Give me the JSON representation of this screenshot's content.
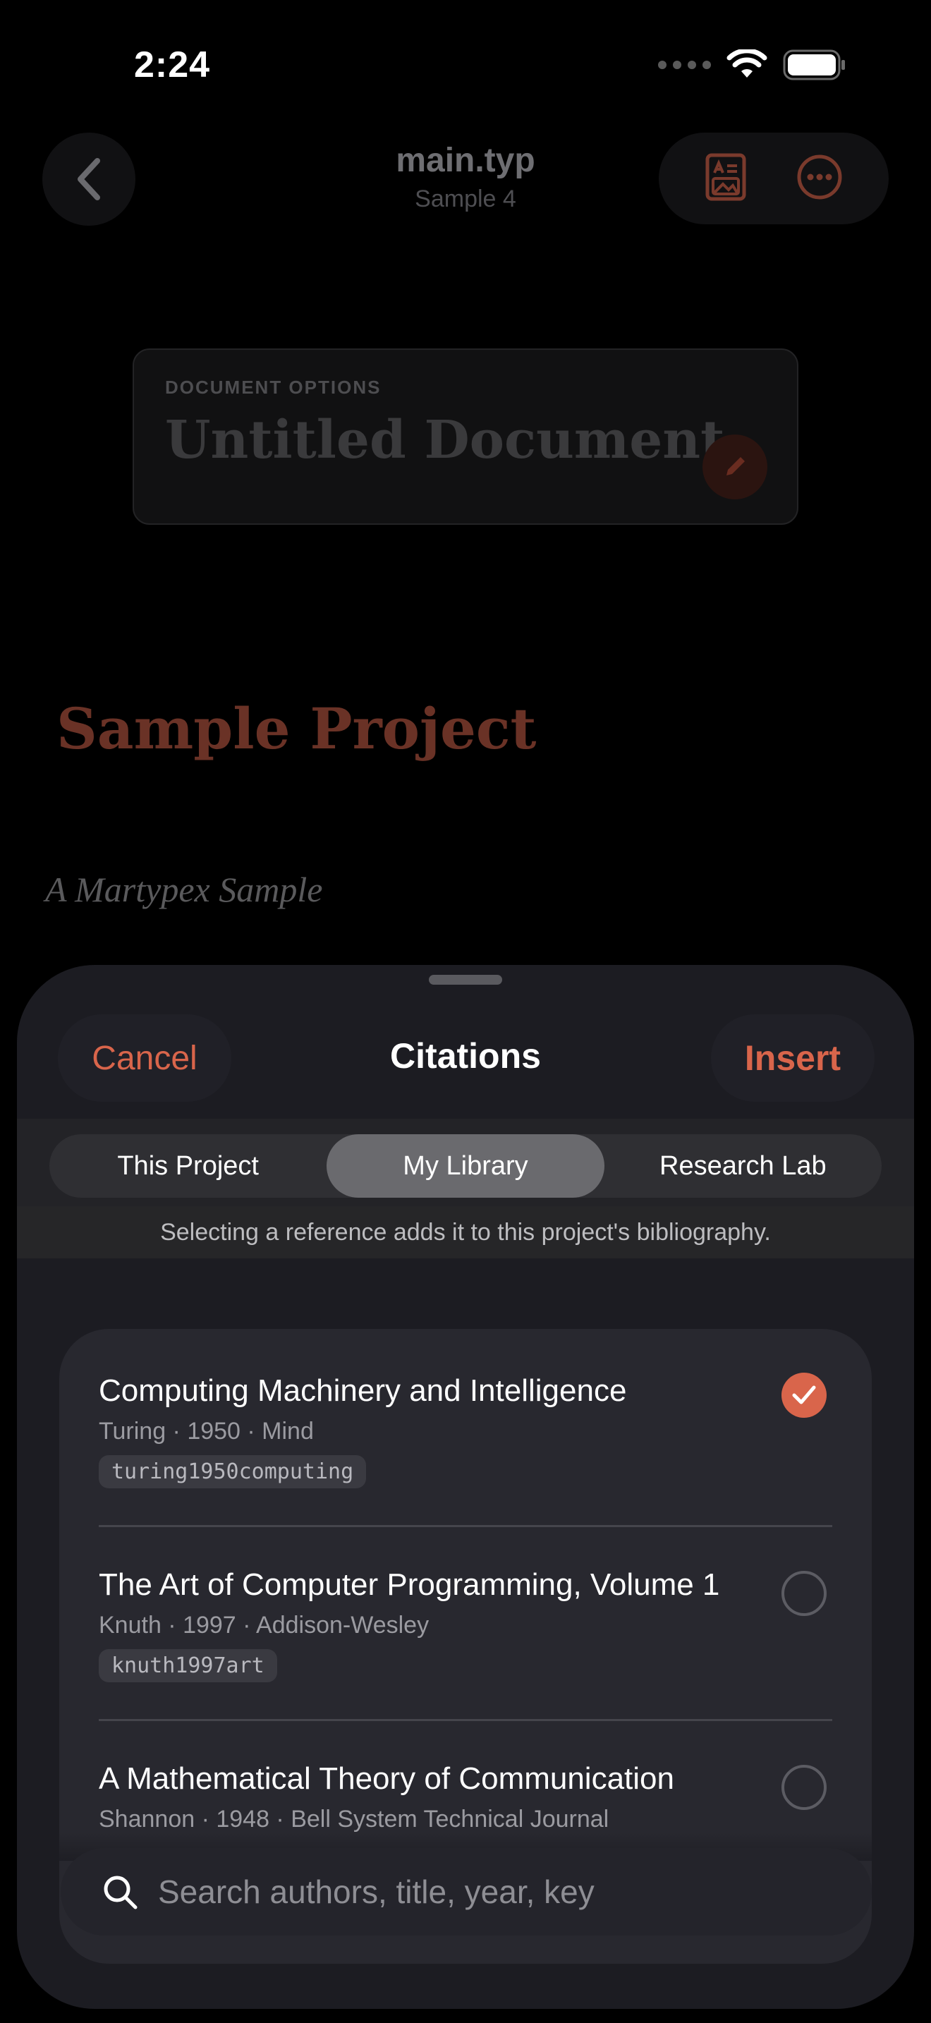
{
  "status_bar": {
    "time": "2:24"
  },
  "nav": {
    "title": "main.typ",
    "subtitle": "Sample 4"
  },
  "document": {
    "options_label": "DOCUMENT OPTIONS",
    "title": "Untitled Document",
    "project_title": "Sample Project",
    "project_subtitle": "A Martypex Sample"
  },
  "sheet": {
    "cancel_label": "Cancel",
    "title": "Citations",
    "insert_label": "Insert",
    "segments": [
      "This Project",
      "My Library",
      "Research Lab"
    ],
    "selected_segment": "My Library",
    "hint": "Selecting a reference adds it to this project's bibliography.",
    "references": [
      {
        "title": "Computing Machinery and Intelligence",
        "meta": "Turing · 1950 · Mind",
        "key": "turing1950computing",
        "selected": true
      },
      {
        "title": "The Art of Computer Programming, Volume 1",
        "meta": "Knuth · 1997 · Addison-Wesley",
        "key": "knuth1997art",
        "selected": false
      },
      {
        "title": "A Mathematical Theory of Communication",
        "meta": "Shannon · 1948 · Bell System Technical Journal",
        "key": "",
        "selected": false
      }
    ],
    "search_placeholder": "Search authors, title, year, key"
  },
  "colors": {
    "accent": "#d9654b",
    "sheet_bg": "#1c1c22",
    "list_bg": "#28282f"
  }
}
